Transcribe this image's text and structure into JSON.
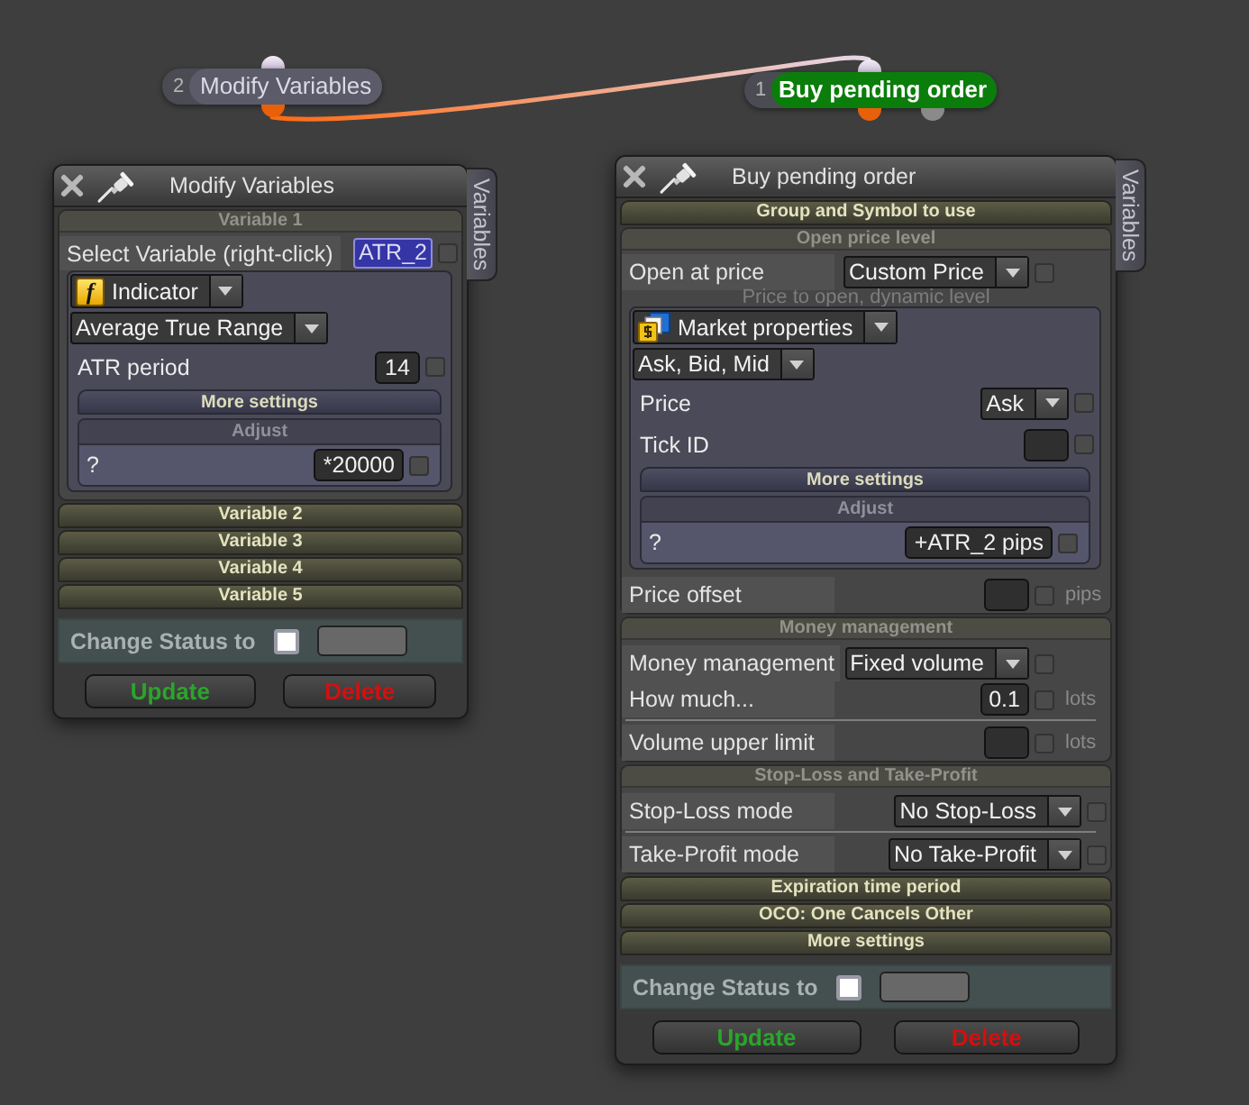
{
  "canvas": {
    "nodes": [
      {
        "number": "2",
        "label": "Modify Variables",
        "selected": false,
        "outputs": [
          {
            "color": "#e8600a",
            "connected": true
          }
        ]
      },
      {
        "number": "1",
        "label": "Buy pending order",
        "selected": true,
        "outputs": [
          {
            "color": "#e8600a"
          },
          {
            "color": "#8a8a8a"
          }
        ]
      }
    ]
  },
  "panels": [
    {
      "title": "Modify Variables",
      "side_tab": "Variables",
      "sections": [
        {
          "title": "Variable 1",
          "expanded": true,
          "rows": [
            {
              "kind": "variable",
              "label": "Select Variable (right-click)",
              "value": "ATR_2",
              "checked": false
            },
            {
              "kind": "group",
              "rows": [
                {
                  "kind": "dropdown",
                  "icon": {
                    "kind": "glyph",
                    "text": "f"
                  },
                  "value": "Indicator"
                },
                {
                  "kind": "dropdown",
                  "value": "Average True Range"
                },
                {
                  "kind": "field",
                  "label": "ATR period",
                  "value": "14",
                  "checked": false
                },
                {
                  "kind": "subsection",
                  "title": "More settings",
                  "expanded": false
                },
                {
                  "kind": "subsection",
                  "title": "Adjust",
                  "expanded": true,
                  "rows": [
                    {
                      "kind": "field",
                      "label": "?",
                      "value": "*20000",
                      "checked": false
                    }
                  ]
                }
              ]
            }
          ]
        },
        {
          "title": "Variable 2",
          "expanded": false
        },
        {
          "title": "Variable 3",
          "expanded": false
        },
        {
          "title": "Variable 4",
          "expanded": false
        },
        {
          "title": "Variable 5",
          "expanded": false
        }
      ],
      "status": {
        "label": "Change Status to",
        "checked": false
      },
      "buttons": [
        {
          "kind": "update",
          "label": "Update"
        },
        {
          "kind": "delete",
          "label": "Delete"
        }
      ]
    },
    {
      "title": "Buy pending order",
      "side_tab": "Variables",
      "sections": [
        {
          "title": "Group and Symbol to use",
          "expanded": false
        },
        {
          "title": "Open price level",
          "expanded": true,
          "rows": [
            {
              "kind": "select",
              "label": "Open at price",
              "value": "Custom Price",
              "checked": false
            },
            {
              "kind": "caption",
              "text": "Price to open, dynamic level"
            },
            {
              "kind": "group",
              "rows": [
                {
                  "kind": "dropdown",
                  "icon": {
                    "kind": "market"
                  },
                  "value": "Market properties"
                },
                {
                  "kind": "dropdown",
                  "value": "Ask, Bid, Mid"
                },
                {
                  "kind": "select",
                  "label": "Price",
                  "value": "Ask",
                  "checked": false
                },
                {
                  "kind": "field",
                  "label": "Tick ID",
                  "checked": false
                },
                {
                  "kind": "subsection",
                  "title": "More settings",
                  "expanded": false
                },
                {
                  "kind": "subsection",
                  "title": "Adjust",
                  "expanded": true,
                  "rows": [
                    {
                      "kind": "field",
                      "label": "?",
                      "value": "+ATR_2 pips",
                      "checked": false
                    }
                  ]
                }
              ]
            },
            {
              "kind": "field",
              "label": "Price offset",
              "checked": false,
              "unit": "pips"
            }
          ]
        },
        {
          "title": "Money management",
          "expanded": true,
          "rows": [
            {
              "kind": "block",
              "rows": [
                {
                  "kind": "select",
                  "label": "Money management",
                  "value": "Fixed volume",
                  "checked": false
                },
                {
                  "kind": "field",
                  "label": "How much...",
                  "value": "0.1",
                  "checked": false,
                  "unit": "lots"
                }
              ]
            },
            {
              "kind": "block",
              "rows": [
                {
                  "kind": "field",
                  "label": "Volume upper limit",
                  "checked": false,
                  "unit": "lots"
                }
              ]
            }
          ]
        },
        {
          "title": "Stop-Loss and Take-Profit",
          "expanded": true,
          "rows": [
            {
              "kind": "block",
              "rows": [
                {
                  "kind": "select",
                  "label": "Stop-Loss mode",
                  "value": "No Stop-Loss",
                  "checked": false
                }
              ]
            },
            {
              "kind": "block",
              "rows": [
                {
                  "kind": "select",
                  "label": "Take-Profit mode",
                  "value": "No Take-Profit",
                  "checked": false
                }
              ]
            }
          ]
        },
        {
          "title": "Expiration time period",
          "expanded": false
        },
        {
          "title": "OCO: One Cancels Other",
          "expanded": false
        },
        {
          "title": "More settings",
          "expanded": false
        }
      ],
      "status": {
        "label": "Change Status to",
        "checked": false
      },
      "buttons": [
        {
          "kind": "update",
          "label": "Update"
        },
        {
          "kind": "delete",
          "label": "Delete"
        }
      ]
    }
  ]
}
